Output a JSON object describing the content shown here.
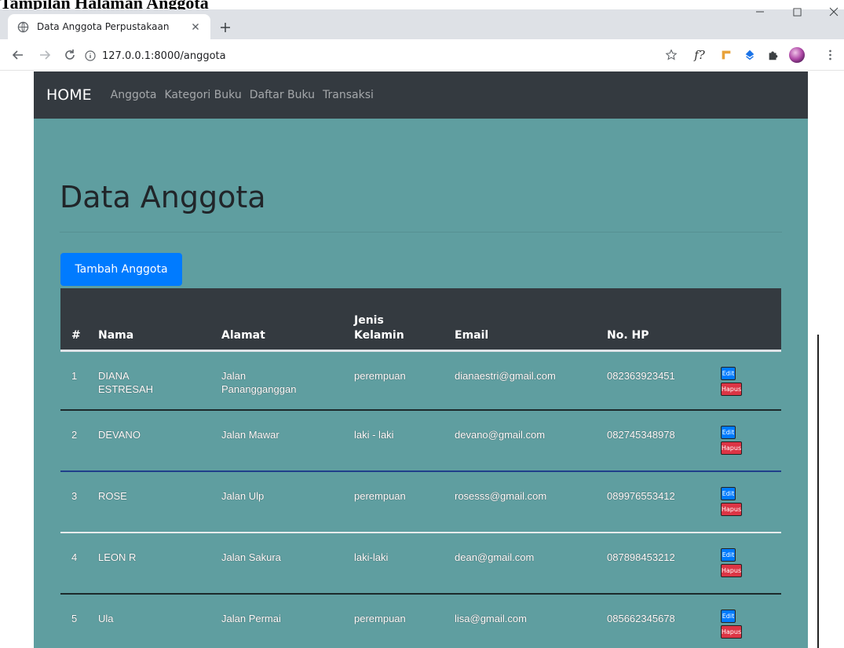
{
  "caption": "Tampilan Halaman Anggota",
  "browser": {
    "tab_title": "Data Anggota Perpustakaan",
    "url": "127.0.0.1:8000/anggota"
  },
  "navbar": {
    "brand": "HOME",
    "links": [
      "Anggota",
      "Kategori Buku",
      "Daftar Buku",
      "Transaksi"
    ]
  },
  "main": {
    "title": "Data Anggota",
    "add_button": "Tambah Anggota"
  },
  "table": {
    "headers": {
      "no": "#",
      "nama": "Nama",
      "alamat": "Alamat",
      "jenis_line1": "Jenis",
      "jenis_line2": "Kelamin",
      "email": "Email",
      "hp": "No. HP"
    },
    "rows": [
      {
        "no": "1",
        "nama_line1": "DIANA",
        "nama_line2": "ESTRESAH",
        "alamat_line1": "Jalan",
        "alamat_line2": "Panangganggan",
        "jk": "perempuan",
        "email": "dianaestri@gmail.com",
        "hp": "082363923451",
        "edit": "Edit",
        "hapus": "Hapus"
      },
      {
        "no": "2",
        "nama_line1": "DEVANO",
        "nama_line2": "",
        "alamat_line1": "Jalan Mawar",
        "alamat_line2": "",
        "jk": "laki - laki",
        "email": "devano@gmail.com",
        "hp": "082745348978",
        "edit": "Edit",
        "hapus": "Hapus"
      },
      {
        "no": "3",
        "nama_line1": "ROSE",
        "nama_line2": "",
        "alamat_line1": "Jalan Ulp",
        "alamat_line2": "",
        "jk": "perempuan",
        "email": "rosesss@gmail.com",
        "hp": "089976553412",
        "edit": "Edit",
        "hapus": "Hapus"
      },
      {
        "no": "4",
        "nama_line1": "LEON R",
        "nama_line2": "",
        "alamat_line1": "Jalan Sakura",
        "alamat_line2": "",
        "jk": "laki-laki",
        "email": "dean@gmail.com",
        "hp": "087898453212",
        "edit": "Edit",
        "hapus": "Hapus"
      },
      {
        "no": "5",
        "nama_line1": "Ula",
        "nama_line2": "",
        "alamat_line1": "Jalan Permai",
        "alamat_line2": "",
        "jk": "perempuan",
        "email": "lisa@gmail.com",
        "hp": "085662345678",
        "edit": "Edit",
        "hapus": "Hapus"
      }
    ]
  },
  "colors": {
    "page_bg": "#5f9ea0",
    "navbar_bg": "#343a40",
    "primary": "#007bff",
    "danger": "#dc3545",
    "row_border_dark": "#1c2a2b",
    "row_border_light": "#e6ecec",
    "row_border_blue": "#1f3f8a"
  },
  "icons": [
    "globe-icon",
    "close-icon",
    "plus-icon",
    "minimize-icon",
    "maximize-icon",
    "window-close-icon",
    "back-icon",
    "forward-icon",
    "reload-icon",
    "info-icon",
    "star-icon",
    "formula-extension-icon",
    "ruler-extension-icon",
    "bookmark-extension-icon",
    "puzzle-icon",
    "profile-avatar",
    "menu-dots-icon"
  ]
}
